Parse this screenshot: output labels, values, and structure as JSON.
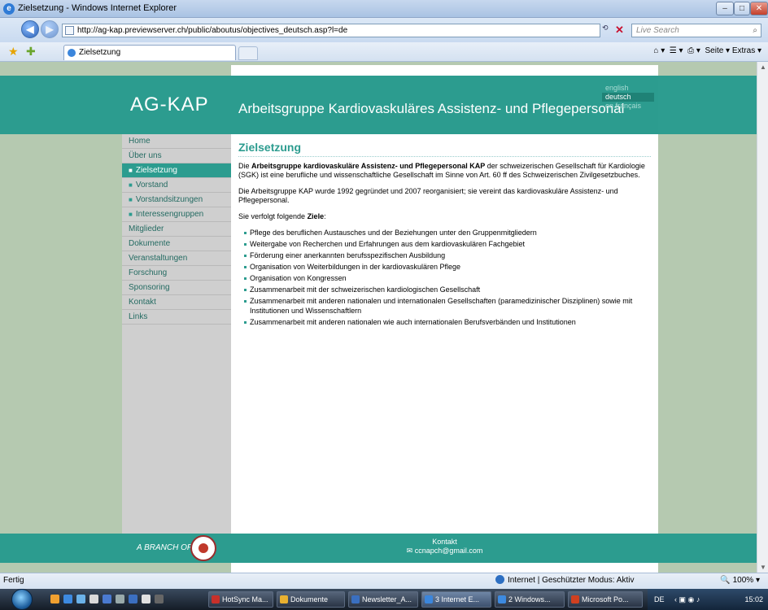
{
  "window": {
    "title": "Zielsetzung - Windows Internet Explorer",
    "address": "http://ag-kap.previewserver.ch/public/aboutus/objectives_deutsch.asp?l=de",
    "search_placeholder": "Live Search",
    "tab_title": "Zielsetzung",
    "commands": "Seite ▾  Extras ▾"
  },
  "site": {
    "logo": "AG-KAP",
    "title": "Arbeitsgruppe Kardiovaskuläres Assistenz- und Pflegepersonal",
    "languages": [
      "english",
      "deutsch",
      "en français"
    ],
    "active_language": "deutsch",
    "nav": [
      {
        "label": "Home",
        "sub": false,
        "active": false
      },
      {
        "label": "Über uns",
        "sub": false,
        "active": false
      },
      {
        "label": "Zielsetzung",
        "sub": true,
        "active": true
      },
      {
        "label": "Vorstand",
        "sub": true,
        "active": false
      },
      {
        "label": "Vorstandsitzungen",
        "sub": true,
        "active": false
      },
      {
        "label": "Interessengruppen",
        "sub": true,
        "active": false
      },
      {
        "label": "Mitglieder",
        "sub": false,
        "active": false
      },
      {
        "label": "Dokumente",
        "sub": false,
        "active": false
      },
      {
        "label": "Veranstaltungen",
        "sub": false,
        "active": false
      },
      {
        "label": "Forschung",
        "sub": false,
        "active": false
      },
      {
        "label": "Sponsoring",
        "sub": false,
        "active": false
      },
      {
        "label": "Kontakt",
        "sub": false,
        "active": false
      },
      {
        "label": "Links",
        "sub": false,
        "active": false
      }
    ],
    "heading": "Zielsetzung",
    "p1_pre": "Die ",
    "p1_bold": "Arbeitsgruppe kardiovaskuläre Assistenz- und Pflegepersonal KAP",
    "p1_post": " der schweizerischen Gesellschaft für Kardiologie (SGK) ist eine berufliche und wissenschaftliche Gesellschaft im Sinne von Art. 60 ff des Schweizerischen Zivilgesetzbuches.",
    "p2": "Die Arbeitsgruppe KAP wurde 1992 gegründet und 2007 reorganisiert; sie vereint das kardiovaskuläre Assistenz- und Pflegepersonal.",
    "p3_pre": "Sie verfolgt folgende ",
    "p3_bold": "Ziele",
    "p3_post": ":",
    "goals": [
      "Pflege des beruflichen Austausches und der Beziehungen unter den Gruppenmitgliedern",
      "Weitergabe von Recherchen und Erfahrungen aus dem kardiovaskulären Fachgebiet",
      "Förderung einer anerkannten berufsspezifischen Ausbildung",
      "Organisation von Weiterbildungen in der kardiovaskulären Pflege",
      "Organisation von Kongressen",
      "Zusammenarbeit mit der schweizerischen kardiologischen Gesellschaft",
      "Zusammenarbeit mit anderen nationalen und internationalen Gesellschaften (paramedizinischer Disziplinen) sowie mit Institutionen und Wissenschaftlern",
      "Zusammenarbeit mit anderen nationalen wie auch internationalen Berufsverbänden und Institutionen"
    ],
    "footer_branch": "A BRANCH OF",
    "footer_contact": "Kontakt",
    "footer_email": "ccnapch@gmail.com"
  },
  "status": {
    "left": "Fertig",
    "zone": "Internet | Geschützter Modus: Aktiv",
    "zoom": "100%"
  },
  "taskbar": {
    "buttons": [
      "HotSync Ma...",
      "Dokumente",
      "Newsletter_A...",
      "3 Internet E...",
      "2 Windows...",
      "Microsoft Po..."
    ],
    "lang": "DE",
    "clock": "15:02"
  }
}
